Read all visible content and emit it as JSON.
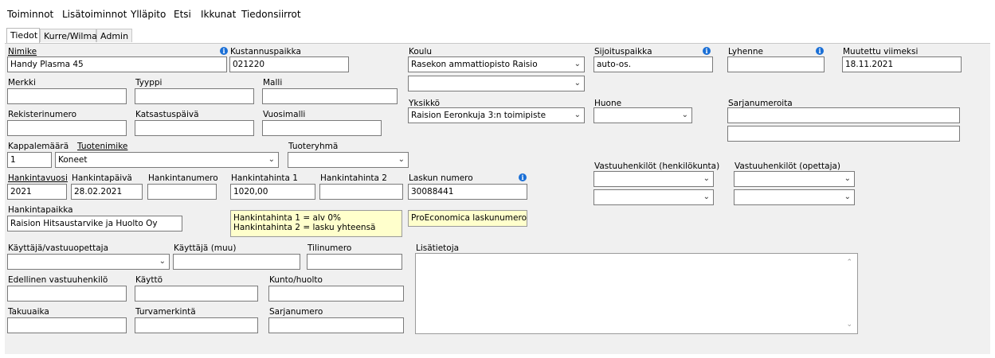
{
  "menu": [
    "Toiminnot",
    "Lisätoiminnot",
    "Ylläpito",
    "Etsi",
    "Ikkunat",
    "Tiedonsiirrot"
  ],
  "tabs": [
    "Tiedot",
    "Kurre/Wilma",
    "Admin"
  ],
  "fields": {
    "nimike": {
      "label": "Nimike",
      "value": "Handy Plasma 45"
    },
    "kustannuspaikka": {
      "label": "Kustannuspaikka",
      "value": "021220"
    },
    "koulu": {
      "label": "Koulu",
      "value": "Rasekon ammattiopisto Raisio"
    },
    "koulu2": {
      "value": ""
    },
    "sijoituspaikka": {
      "label": "Sijoituspaikka",
      "value": "auto-os."
    },
    "lyhenne": {
      "label": "Lyhenne",
      "value": ""
    },
    "muutettu": {
      "label": "Muutettu viimeksi",
      "value": "18.11.2021"
    },
    "merkki": {
      "label": "Merkki",
      "value": ""
    },
    "tyyppi": {
      "label": "Tyyppi",
      "value": ""
    },
    "malli": {
      "label": "Malli",
      "value": ""
    },
    "yksikko": {
      "label": "Yksikkö",
      "value": "Raision Eeronkuja 3:n toimipiste"
    },
    "huone": {
      "label": "Huone",
      "value": ""
    },
    "sarjanumeroita": {
      "label": "Sarjanumeroita",
      "value": ""
    },
    "rekisterinumero": {
      "label": "Rekisterinumero",
      "value": ""
    },
    "katsastuspaiva": {
      "label": "Katsastuspäivä",
      "value": ""
    },
    "vuosimalli": {
      "label": "Vuosimalli",
      "value": ""
    },
    "kappalemaara": {
      "label": "Kappalemäärä",
      "value": "1"
    },
    "tuotenimike": {
      "label": "Tuotenimike",
      "value": "Koneet"
    },
    "tuoteryhma": {
      "label": "Tuoteryhmä",
      "value": ""
    },
    "vastuu_henk": {
      "label": "Vastuuhenkilöt (henkilökunta)"
    },
    "vastuu_opet": {
      "label": "Vastuuhenkilöt (opettaja)"
    },
    "hankintavuosi": {
      "label": "Hankintavuosi",
      "value": "2021"
    },
    "hankintapaiva": {
      "label": "Hankintapäivä",
      "value": "28.02.2021"
    },
    "hankintanumero": {
      "label": "Hankintanumero",
      "value": ""
    },
    "hankintahinta1": {
      "label": "Hankintahinta 1",
      "value": "1020,00"
    },
    "hankintahinta2": {
      "label": "Hankintahinta 2",
      "value": ""
    },
    "laskun_numero": {
      "label": "Laskun numero",
      "value": "30088441"
    },
    "hankintapaikka": {
      "label": "Hankintapaikka",
      "value": "Raision Hitsaustarvike ja Huolto Oy"
    },
    "hinta_note": {
      "line1": "Hankintahinta 1 = alv 0%",
      "line2": "Hankintahinta 2 = lasku yhteensä"
    },
    "proeconomica_note": "ProEconomica laskunumero",
    "kayttaja_vastuu": {
      "label": "Käyttäjä/vastuuopettaja",
      "value": ""
    },
    "kayttaja_muu": {
      "label": "Käyttäjä (muu)",
      "value": ""
    },
    "tilinumero": {
      "label": "Tilinumero",
      "value": ""
    },
    "lisatietoja": {
      "label": "Lisätietoja",
      "value": ""
    },
    "edellinen": {
      "label": "Edellinen vastuuhenkilö",
      "value": ""
    },
    "kaytto": {
      "label": "Käyttö",
      "value": ""
    },
    "kunto": {
      "label": "Kunto/huolto",
      "value": ""
    },
    "takuuaika": {
      "label": "Takuuaika",
      "value": ""
    },
    "turvamerkinta": {
      "label": "Turvamerkintä",
      "value": ""
    },
    "sarjanumero": {
      "label": "Sarjanumero",
      "value": ""
    }
  },
  "icons": {
    "info": "info-icon",
    "chevron": "chevron-down-icon"
  },
  "colors": {
    "info_icon": "#1a6fd6",
    "note_bg": "#ffffcc",
    "panel_bg": "#f0f0f0"
  }
}
